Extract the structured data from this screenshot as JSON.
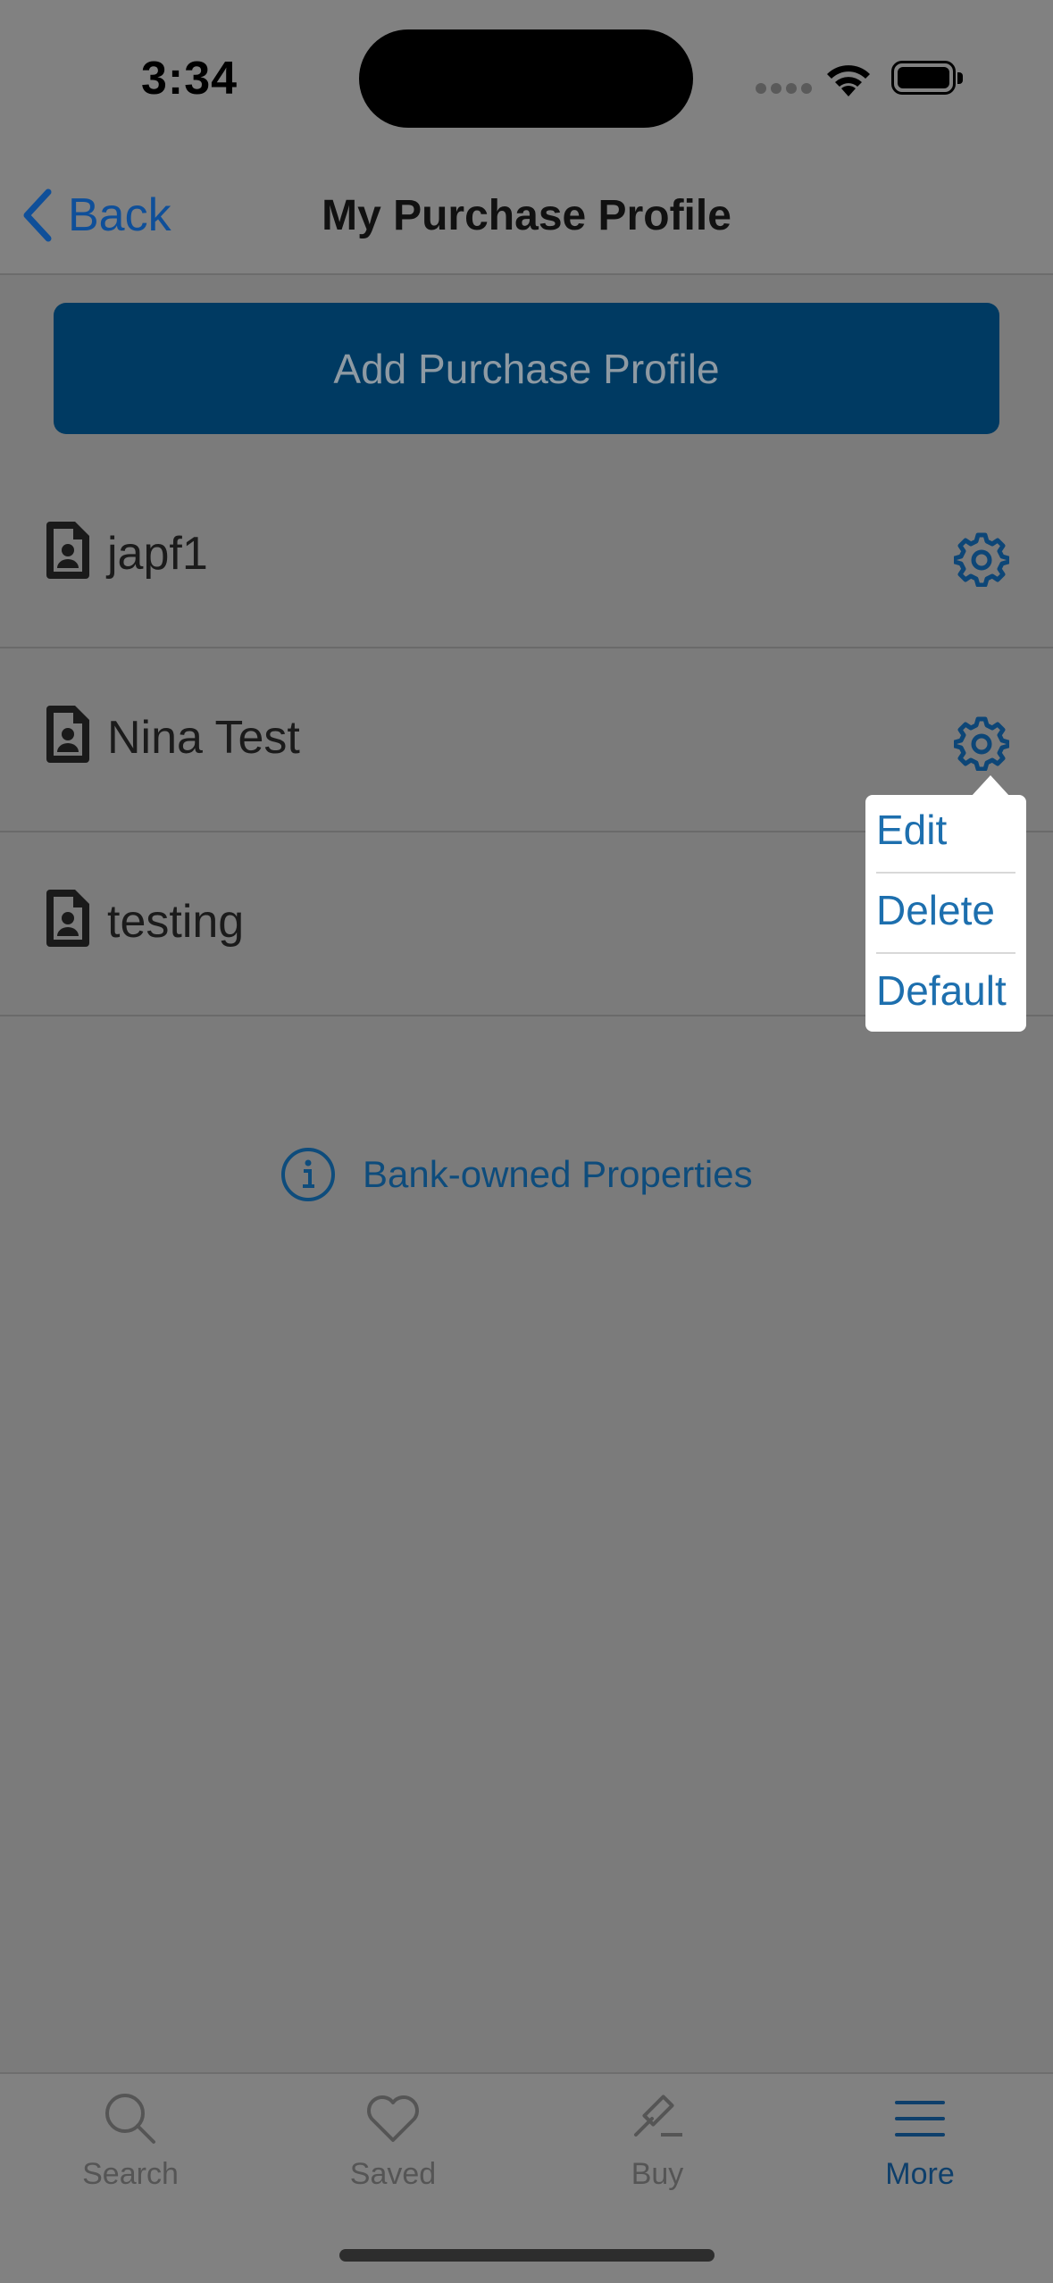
{
  "status_bar": {
    "time": "3:34"
  },
  "nav": {
    "back_label": "Back",
    "title": "My Purchase Profile"
  },
  "add_button_label": "Add Purchase Profile",
  "profiles": [
    {
      "name": "japf1"
    },
    {
      "name": "Nina Test"
    },
    {
      "name": "testing"
    }
  ],
  "popover_menu": {
    "items": [
      "Edit",
      "Delete",
      "Default"
    ]
  },
  "info_link": {
    "label": "Bank-owned Properties"
  },
  "tabs": [
    {
      "label": "Search",
      "icon": "search-icon"
    },
    {
      "label": "Saved",
      "icon": "heart-icon"
    },
    {
      "label": "Buy",
      "icon": "gavel-icon"
    },
    {
      "label": "More",
      "icon": "menu-icon",
      "active": true
    }
  ],
  "colors": {
    "accent": "#0f4f99",
    "button": "#003a62",
    "dim_background": "#7b7b7b"
  }
}
